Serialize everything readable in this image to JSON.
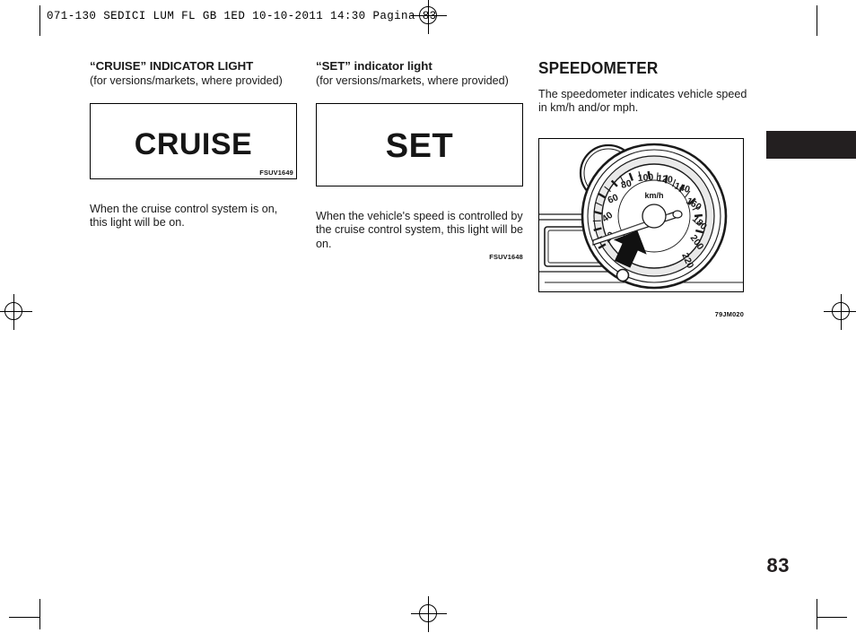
{
  "header": {
    "slug": "071-130 SEDICI LUM FL GB 1ED   10-10-2011   14:30   Pagina 83"
  },
  "page": {
    "number": "83",
    "tab_color": "#231f20"
  },
  "columns": {
    "cruise": {
      "title": "“CRUISE” INDICATOR LIGHT",
      "subtitle": "(for versions/markets, where provided)",
      "figure": {
        "telltale_text": "CRUISE",
        "code": "FSUV1649"
      },
      "body": "When the cruise control system is on, this light will be on."
    },
    "set": {
      "title": "“SET” indicator light",
      "subtitle": "(for versions/markets, where provided)",
      "figure": {
        "telltale_text": "SET",
        "code": "FSUV1648"
      },
      "body": "When the vehicle's speed is controlled by the cruise control system, this light will be on."
    },
    "speedometer": {
      "title": "SPEEDOMETER",
      "body": "The speedometer indicates vehicle speed in km/h and/or mph.",
      "figure": {
        "code": "79JM020",
        "unit_label": "km/h",
        "dial_values": [
          "20",
          "40",
          "60",
          "80",
          "100",
          "120",
          "140",
          "160",
          "180",
          "200",
          "220"
        ]
      }
    }
  }
}
